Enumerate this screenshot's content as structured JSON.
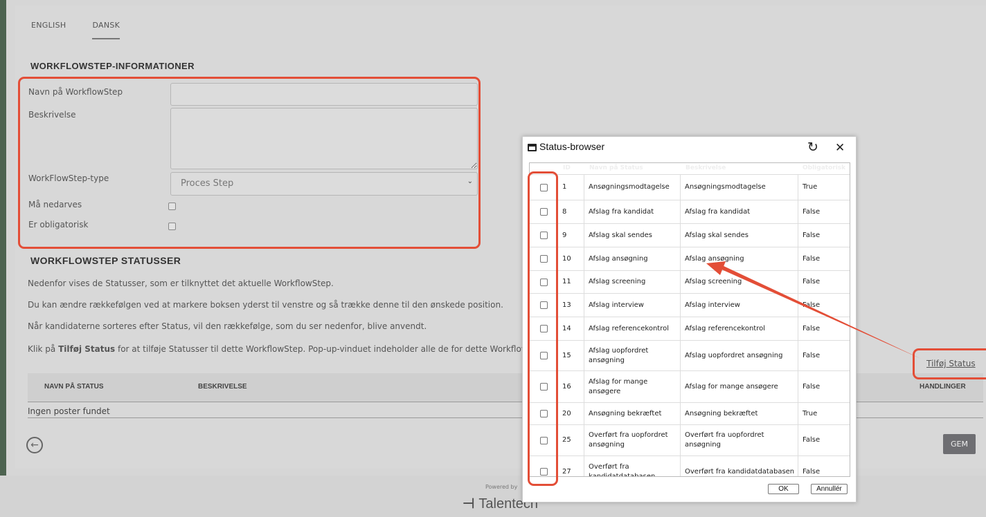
{
  "tabs": [
    {
      "label": "ENGLISH"
    },
    {
      "label": "DANSK"
    }
  ],
  "info_section": {
    "title": "WORKFLOWSTEP-INFORMATIONER",
    "name_label": "Navn på WorkflowStep",
    "name_value": "",
    "desc_label": "Beskrivelse",
    "desc_value": "",
    "type_label": "WorkFlowStep-type",
    "type_value": "Proces Step",
    "inherit_label": "Må nedarves",
    "mandatory_label": "Er obligatorisk"
  },
  "status_section": {
    "title": "WORKFLOWSTEP STATUSSER",
    "para1": "Nedenfor vises de Statusser, som er tilknyttet det aktuelle WorkflowStep.",
    "para2": "Du kan ændre rækkefølgen ved at markere boksen yderst til venstre og så trække denne til den ønskede position.",
    "para3": "Når kandidaterne sorteres efter Status, vil den rækkefølge, som du ser nedenfor, blive anvendt.",
    "para4_pre": "Klik på ",
    "para4_bold": "Tilføj Status",
    "para4_post": " for at tilføje Statusser til dette WorkflowStep. Pop-up-vinduet indeholder alle de for dette WorkflowStep",
    "add_link": "Tilføj Status",
    "col_name": "NAVN PÅ STATUS",
    "col_desc": "BESKRIVELSE",
    "col_actions": "HANDLINGER",
    "empty": "Ingen poster fundet",
    "save_label": "GEM"
  },
  "footer": {
    "powered": "Powered by",
    "brand": "Talentech"
  },
  "modal": {
    "title": "Status-browser",
    "columns": [
      "ID",
      "Navn på Status",
      "Beskrivelse",
      "Obligatorisk"
    ],
    "rows": [
      {
        "id": "1",
        "name": "Ansøgningsmodtagelse",
        "desc": "Ansøgningsmodtagelse",
        "flag": "True"
      },
      {
        "id": "8",
        "name": "Afslag fra kandidat",
        "desc": "Afslag fra kandidat",
        "flag": "False"
      },
      {
        "id": "9",
        "name": "Afslag skal sendes",
        "desc": "Afslag skal sendes",
        "flag": "False"
      },
      {
        "id": "10",
        "name": "Afslag ansøgning",
        "desc": "Afslag ansøgning",
        "flag": "False"
      },
      {
        "id": "11",
        "name": "Afslag screening",
        "desc": "Afslag screening",
        "flag": "False"
      },
      {
        "id": "13",
        "name": "Afslag interview",
        "desc": "Afslag interview",
        "flag": "False"
      },
      {
        "id": "14",
        "name": "Afslag referencekontrol",
        "desc": "Afslag referencekontrol",
        "flag": "False"
      },
      {
        "id": "15",
        "name": "Afslag uopfordret ansøgning",
        "desc": "Afslag uopfordret ansøgning",
        "flag": "False"
      },
      {
        "id": "16",
        "name": "Afslag for mange ansøgere",
        "desc": "Afslag for mange ansøgere",
        "flag": "False"
      },
      {
        "id": "20",
        "name": "Ansøgning bekræftet",
        "desc": "Ansøgning bekræftet",
        "flag": "True"
      },
      {
        "id": "25",
        "name": "Overført fra uopfordret ansøgning",
        "desc": "Overført fra uopfordret ansøgning",
        "flag": "False"
      },
      {
        "id": "27",
        "name": "Overført fra kandidatdatabasen",
        "desc": "Overført fra kandidatdatabasen",
        "flag": "False"
      }
    ],
    "ok_label": "OK",
    "cancel_label": "Annullér"
  },
  "colors": {
    "highlight": "#e34e37",
    "button": "#6e6e72"
  }
}
